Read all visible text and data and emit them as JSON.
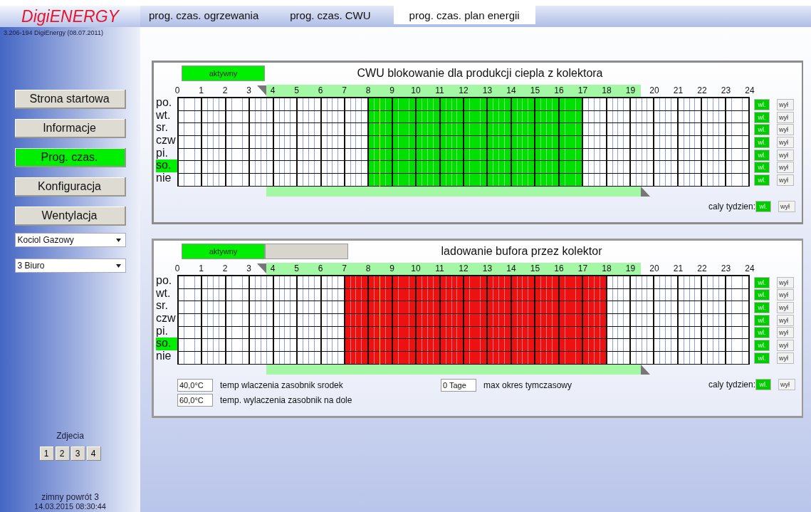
{
  "brand": {
    "logo": "DigiENERGY",
    "version": "3.206-194 DigiEnergy (08.07.2011)"
  },
  "tabs": [
    {
      "label": "prog. czas. ogrzewania",
      "selected": false
    },
    {
      "label": "prog. czas. CWU",
      "selected": false
    },
    {
      "label": "prog. czas. plan energii",
      "selected": true
    }
  ],
  "nav": [
    {
      "label": "Strona startowa",
      "selected": false
    },
    {
      "label": "Informacje",
      "selected": false
    },
    {
      "label": "Prog. czas.",
      "selected": true
    },
    {
      "label": "Konfiguracja",
      "selected": false
    },
    {
      "label": "Wentylacja",
      "selected": false
    }
  ],
  "selects": [
    {
      "value": "Kociol Gazowy"
    },
    {
      "value": "3 Biuro"
    }
  ],
  "photos": {
    "title": "Zdjecia",
    "buttons": [
      "1",
      "2",
      "3",
      "4"
    ]
  },
  "status": {
    "line1": "zimny powrót 3",
    "line2": "14.03.2015 08:30:44"
  },
  "schedules": [
    {
      "active_label": "aktywny",
      "blank_button": false,
      "title": "CWU blokowanie dla produkcji ciepla z kolektora",
      "color": "#00e000",
      "hour_labels": [
        "0",
        "1",
        "2",
        "3",
        "4",
        "5",
        "6",
        "7",
        "8",
        "9",
        "10",
        "11",
        "12",
        "13",
        "14",
        "15",
        "16",
        "17",
        "18",
        "19",
        "20",
        "21",
        "22",
        "23",
        "24"
      ],
      "start_handle": {
        "level": 0.155
      },
      "end_handle": {
        "level": 0.81
      },
      "now_marker": {
        "level": 0.354
      },
      "days": [
        {
          "label": "po.",
          "today": false,
          "on": "wl.",
          "off": "wył",
          "hours": [
            false,
            false,
            false,
            false,
            false,
            false,
            false,
            false,
            true,
            true,
            true,
            true,
            true,
            true,
            true,
            true,
            true,
            false,
            false,
            false,
            false,
            false,
            false,
            false
          ]
        },
        {
          "label": "wt.",
          "today": false,
          "on": "wl.",
          "off": "wył",
          "hours": [
            false,
            false,
            false,
            false,
            false,
            false,
            false,
            false,
            true,
            true,
            true,
            true,
            true,
            true,
            true,
            true,
            true,
            false,
            false,
            false,
            false,
            false,
            false,
            false
          ]
        },
        {
          "label": "sr.",
          "today": false,
          "on": "wl.",
          "off": "wył",
          "hours": [
            false,
            false,
            false,
            false,
            false,
            false,
            false,
            false,
            true,
            true,
            true,
            true,
            true,
            true,
            true,
            true,
            true,
            false,
            false,
            false,
            false,
            false,
            false,
            false
          ]
        },
        {
          "label": "czw",
          "today": false,
          "on": "wl.",
          "off": "wył",
          "hours": [
            false,
            false,
            false,
            false,
            false,
            false,
            false,
            false,
            true,
            true,
            true,
            true,
            true,
            true,
            true,
            true,
            true,
            false,
            false,
            false,
            false,
            false,
            false,
            false
          ]
        },
        {
          "label": "pi.",
          "today": false,
          "on": "wl.",
          "off": "wył",
          "hours": [
            false,
            false,
            false,
            false,
            false,
            false,
            false,
            false,
            true,
            true,
            true,
            true,
            true,
            true,
            true,
            true,
            true,
            false,
            false,
            false,
            false,
            false,
            false,
            false
          ]
        },
        {
          "label": "so.",
          "today": true,
          "on": "wl.",
          "off": "wył",
          "hours": [
            false,
            false,
            false,
            false,
            false,
            false,
            false,
            false,
            true,
            true,
            true,
            true,
            true,
            true,
            true,
            true,
            true,
            false,
            false,
            false,
            false,
            false,
            false,
            false
          ]
        },
        {
          "label": "nie",
          "today": false,
          "on": "wl.",
          "off": "wył",
          "hours": [
            false,
            false,
            false,
            false,
            false,
            false,
            false,
            false,
            true,
            true,
            true,
            true,
            true,
            true,
            true,
            true,
            true,
            false,
            false,
            false,
            false,
            false,
            false,
            false
          ]
        }
      ],
      "week": {
        "label": "caly tydzien:",
        "on": "wl.",
        "off": "wył"
      }
    },
    {
      "active_label": "aktywny",
      "blank_button": true,
      "title": "ladowanie bufora przez kolektor",
      "color": "#ee1111",
      "hour_labels": [
        "0",
        "1",
        "2",
        "3",
        "4",
        "5",
        "6",
        "7",
        "8",
        "9",
        "10",
        "11",
        "12",
        "13",
        "14",
        "15",
        "16",
        "17",
        "18",
        "19",
        "20",
        "21",
        "22",
        "23",
        "24"
      ],
      "start_handle": {
        "level": 0.155
      },
      "end_handle": {
        "level": 0.81
      },
      "now_marker": {
        "level": 0.354
      },
      "days": [
        {
          "label": "po.",
          "today": false,
          "on": "wl.",
          "off": "wył",
          "hours": [
            false,
            false,
            false,
            false,
            false,
            false,
            false,
            true,
            true,
            true,
            true,
            true,
            true,
            true,
            true,
            true,
            true,
            true,
            false,
            false,
            false,
            false,
            false,
            false
          ]
        },
        {
          "label": "wt.",
          "today": false,
          "on": "wl.",
          "off": "wył",
          "hours": [
            false,
            false,
            false,
            false,
            false,
            false,
            false,
            true,
            true,
            true,
            true,
            true,
            true,
            true,
            true,
            true,
            true,
            true,
            false,
            false,
            false,
            false,
            false,
            false
          ]
        },
        {
          "label": "sr.",
          "today": false,
          "on": "wl.",
          "off": "wył",
          "hours": [
            false,
            false,
            false,
            false,
            false,
            false,
            false,
            true,
            true,
            true,
            true,
            true,
            true,
            true,
            true,
            true,
            true,
            true,
            false,
            false,
            false,
            false,
            false,
            false
          ]
        },
        {
          "label": "czw",
          "today": false,
          "on": "wl.",
          "off": "wył",
          "hours": [
            false,
            false,
            false,
            false,
            false,
            false,
            false,
            true,
            true,
            true,
            true,
            true,
            true,
            true,
            true,
            true,
            true,
            true,
            false,
            false,
            false,
            false,
            false,
            false
          ]
        },
        {
          "label": "pi.",
          "today": false,
          "on": "wl.",
          "off": "wył",
          "hours": [
            false,
            false,
            false,
            false,
            false,
            false,
            false,
            true,
            true,
            true,
            true,
            true,
            true,
            true,
            true,
            true,
            true,
            true,
            false,
            false,
            false,
            false,
            false,
            false
          ]
        },
        {
          "label": "so.",
          "today": true,
          "on": "wl.",
          "off": "wył",
          "hours": [
            false,
            false,
            false,
            false,
            false,
            false,
            false,
            true,
            true,
            true,
            true,
            true,
            true,
            true,
            true,
            true,
            true,
            true,
            false,
            false,
            false,
            false,
            false,
            false
          ]
        },
        {
          "label": "nie",
          "today": false,
          "on": "wl.",
          "off": "wył",
          "hours": [
            false,
            false,
            false,
            false,
            false,
            false,
            false,
            true,
            true,
            true,
            true,
            true,
            true,
            true,
            true,
            true,
            true,
            true,
            false,
            false,
            false,
            false,
            false,
            false
          ]
        }
      ],
      "week": {
        "label": "caly tydzien:",
        "on": "wl.",
        "off": "wył"
      },
      "fields": [
        {
          "value": "40,0°C",
          "label": "temp wlaczenia zasobnik srodek"
        },
        {
          "value": "60,0°C",
          "label": "temp. wylaczenia zasobnik na dole"
        },
        {
          "value": "0 Tage",
          "label": "max okres tymczasowy"
        }
      ]
    }
  ]
}
